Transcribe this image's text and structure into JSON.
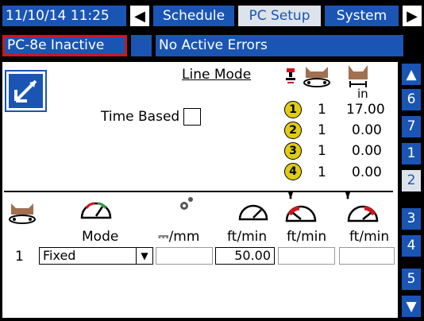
{
  "topbar": {
    "datetime": "11/10/14 11:25",
    "nav_left_icon": "arrow-left-icon",
    "nav_right_icon": "arrow-right-icon",
    "tabs": [
      {
        "label": "Schedule"
      },
      {
        "label": "PC Setup"
      },
      {
        "label": "System"
      }
    ]
  },
  "status": {
    "unit": "PC-8e Inactive",
    "errors": "No Active Errors"
  },
  "line_mode": {
    "title": "Line Mode",
    "time_based_label": "Time Based"
  },
  "guns": {
    "unit_label": "in",
    "rows": [
      {
        "num": "1",
        "count": "1",
        "value": "17.00"
      },
      {
        "num": "2",
        "count": "1",
        "value": "0.00"
      },
      {
        "num": "3",
        "count": "1",
        "value": "0.00"
      },
      {
        "num": "4",
        "count": "1",
        "value": "0.00"
      }
    ]
  },
  "table": {
    "headers": [
      "Mode",
      "⎓/mm",
      "ft/min",
      "ft/min",
      "ft/min"
    ],
    "row": {
      "index": "1",
      "mode_value": "Fixed",
      "speed_value": "50.00"
    }
  },
  "side_nav": {
    "items": [
      "6",
      "7",
      "1",
      "2",
      "3",
      "4",
      "5"
    ]
  },
  "colors": {
    "accent_blue": "#1a55b4",
    "error_red": "#d2141e",
    "gun_yellow": "#e0cc12"
  }
}
